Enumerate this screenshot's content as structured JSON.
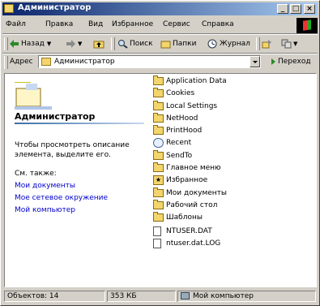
{
  "window": {
    "title": "Администратор"
  },
  "menu": [
    "Файл",
    "Правка",
    "Вид",
    "Избранное",
    "Сервис",
    "Справка"
  ],
  "toolbar": {
    "back": "Назад",
    "search": "Поиск",
    "folders": "Папки",
    "journal": "Журнал"
  },
  "address": {
    "label": "Адрес",
    "value": "Администратор",
    "go": "Переход"
  },
  "left_panel": {
    "title": "Администратор",
    "description": "Чтобы просмотреть описание элемента, выделите его.",
    "see_also": "См. также:",
    "links": [
      "Мои документы",
      "Мое сетевое окружение",
      "Мой компьютер"
    ]
  },
  "files": [
    {
      "name": "Application Data",
      "icon": "folder-icon"
    },
    {
      "name": "Cookies",
      "icon": "folder-icon"
    },
    {
      "name": "Local Settings",
      "icon": "folder-icon"
    },
    {
      "name": "NetHood",
      "icon": "folder-icon"
    },
    {
      "name": "PrintHood",
      "icon": "folder-icon"
    },
    {
      "name": "Recent",
      "icon": "recent-icon"
    },
    {
      "name": "SendTo",
      "icon": "folder-icon"
    },
    {
      "name": "Главное меню",
      "icon": "folder-icon"
    },
    {
      "name": "Избранное",
      "icon": "favorites-icon"
    },
    {
      "name": "Мои документы",
      "icon": "folder-icon"
    },
    {
      "name": "Рабочий стол",
      "icon": "folder-icon"
    },
    {
      "name": "Шаблоны",
      "icon": "folder-icon"
    },
    {
      "name": "NTUSER.DAT",
      "icon": "file-icon"
    },
    {
      "name": "ntuser.dat.LOG",
      "icon": "file-icon"
    }
  ],
  "status": {
    "objects": "Объектов: 14",
    "size": "353 КБ",
    "location": "Мой компьютер"
  }
}
